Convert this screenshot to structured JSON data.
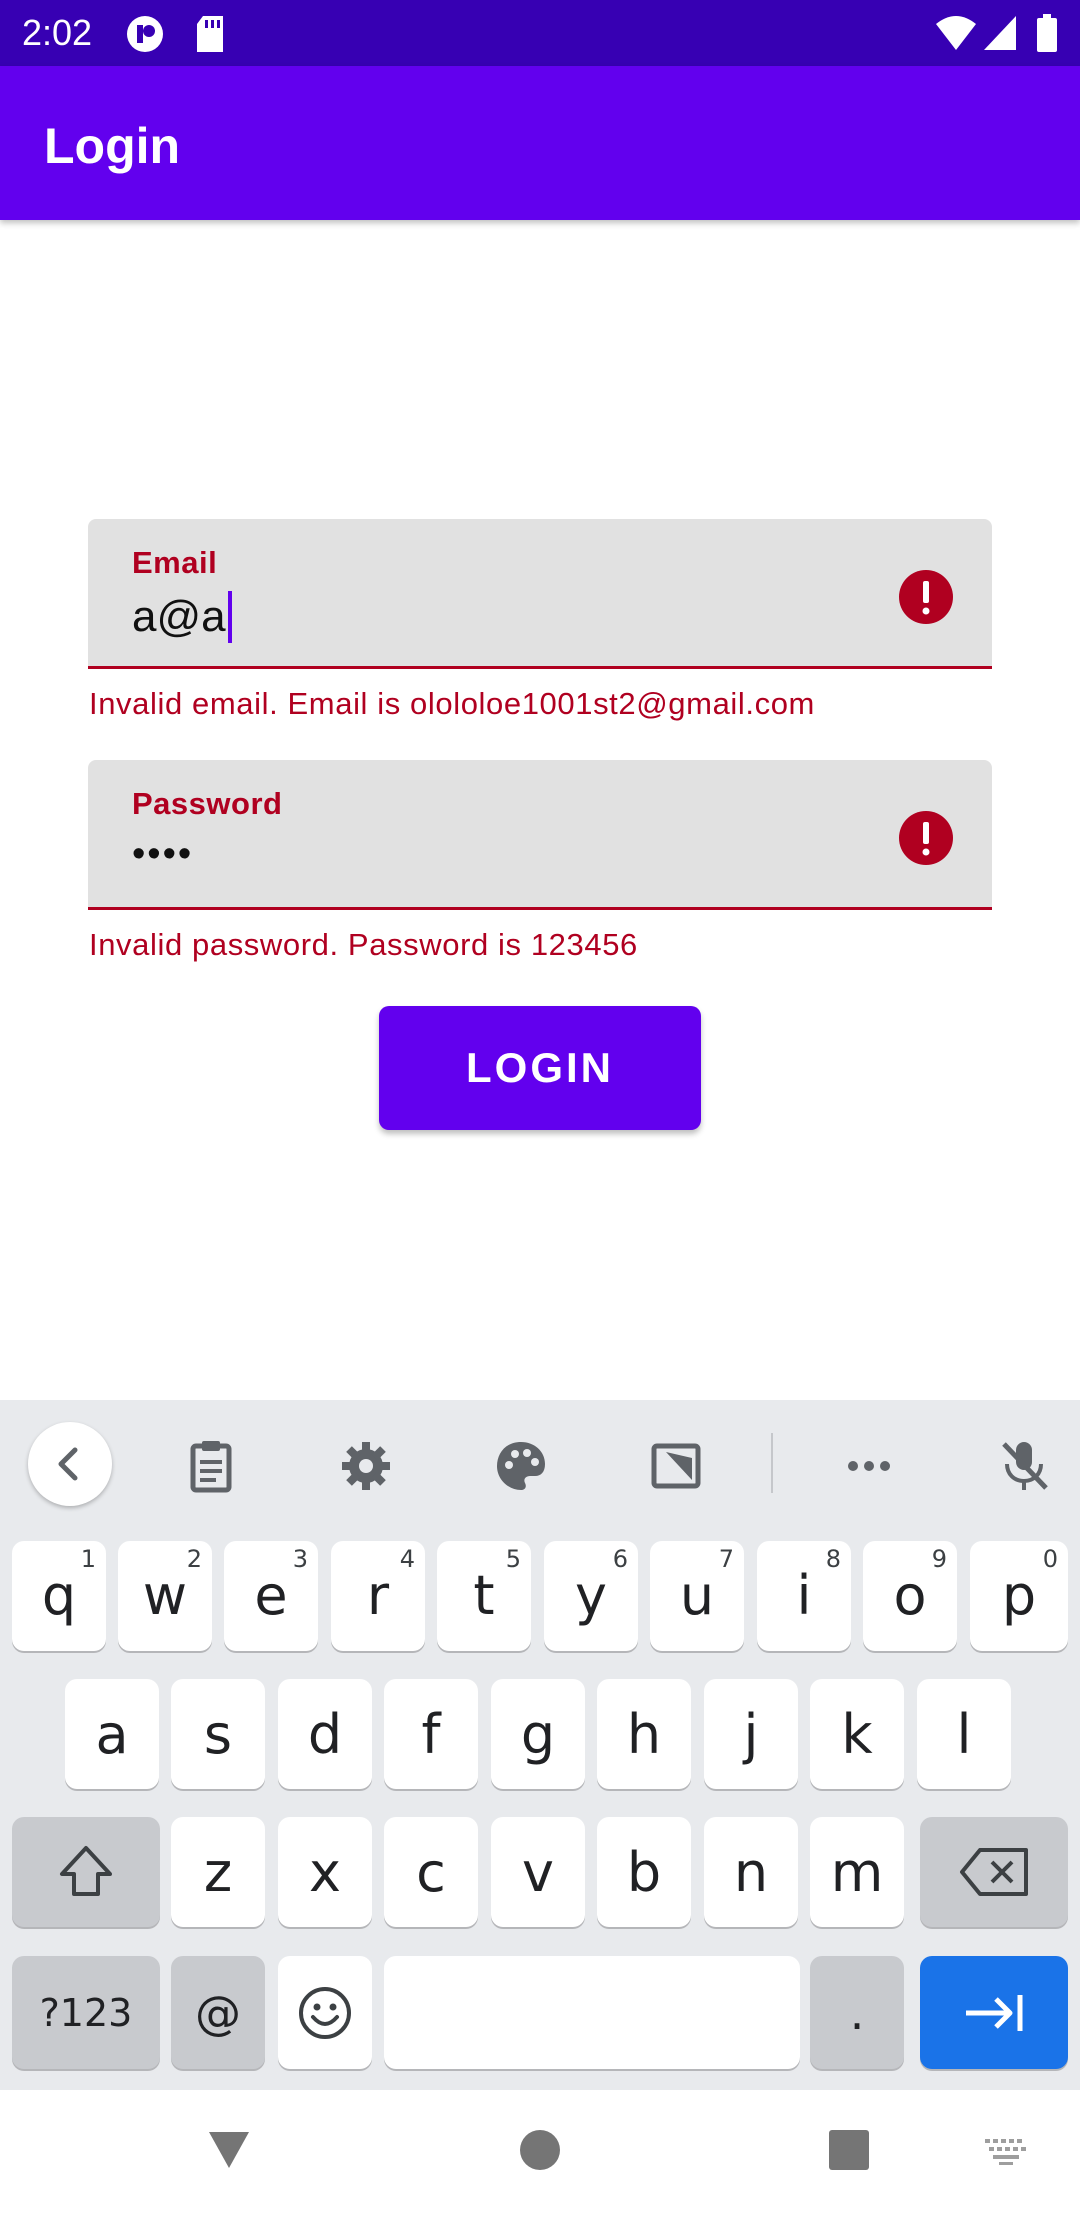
{
  "status_bar": {
    "time": "2:02",
    "icons": [
      "notification-app-icon",
      "sd-card-icon",
      "wifi-icon",
      "cellular-signal-icon",
      "battery-icon"
    ]
  },
  "app_bar": {
    "title": "Login"
  },
  "form": {
    "email": {
      "label": "Email",
      "value": "a@a",
      "error": "Invalid email. Email is olololoe1001st2@gmail.com"
    },
    "password": {
      "label": "Password",
      "value": "••••",
      "error": "Invalid password. Password is 123456"
    },
    "login_button": "LOGIN"
  },
  "keyboard": {
    "toolbar": [
      "back-icon",
      "clipboard-icon",
      "settings-icon",
      "theme-palette-icon",
      "one-handed-icon",
      "more-icon",
      "mic-off-icon"
    ],
    "row1": [
      {
        "k": "q",
        "h": "1"
      },
      {
        "k": "w",
        "h": "2"
      },
      {
        "k": "e",
        "h": "3"
      },
      {
        "k": "r",
        "h": "4"
      },
      {
        "k": "t",
        "h": "5"
      },
      {
        "k": "y",
        "h": "6"
      },
      {
        "k": "u",
        "h": "7"
      },
      {
        "k": "i",
        "h": "8"
      },
      {
        "k": "o",
        "h": "9"
      },
      {
        "k": "p",
        "h": "0"
      }
    ],
    "row2": [
      "a",
      "s",
      "d",
      "f",
      "g",
      "h",
      "j",
      "k",
      "l"
    ],
    "row3": [
      "z",
      "x",
      "c",
      "v",
      "b",
      "n",
      "m"
    ],
    "symbols_key": "?123",
    "at_key": "@",
    "period_key": ".",
    "colors": {
      "enter_key": "#1A73E8",
      "accent": "#6200EE",
      "error": "#B00020"
    }
  },
  "nav_bar": [
    "back-triangle-icon",
    "home-circle-icon",
    "recents-square-icon",
    "keyboard-switch-icon"
  ]
}
